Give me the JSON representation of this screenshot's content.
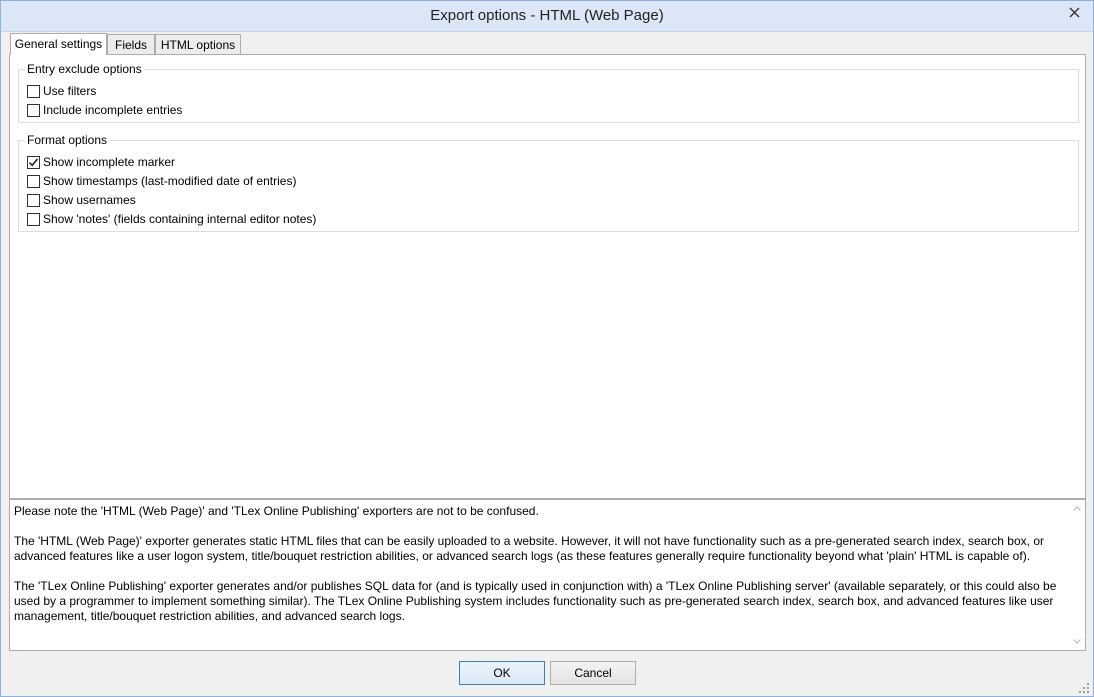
{
  "window": {
    "title": "Export options - HTML (Web Page)"
  },
  "tabs": [
    {
      "label": "General settings",
      "active": true
    },
    {
      "label": "Fields",
      "active": false
    },
    {
      "label": "HTML options",
      "active": false
    }
  ],
  "entry_exclude": {
    "legend": "Entry exclude options",
    "options": [
      {
        "label": "Use filters",
        "checked": false
      },
      {
        "label": "Include incomplete entries",
        "checked": false
      }
    ]
  },
  "format_options": {
    "legend": "Format options",
    "options": [
      {
        "label": "Show incomplete marker",
        "checked": true
      },
      {
        "label": "Show timestamps (last-modified date of entries)",
        "checked": false
      },
      {
        "label": "Show usernames",
        "checked": false
      },
      {
        "label": "Show 'notes' (fields containing internal editor notes)",
        "checked": false
      }
    ]
  },
  "notes": {
    "paragraphs": [
      "Please note the 'HTML (Web Page)' and 'TLex Online Publishing' exporters are not to be confused.",
      "The 'HTML (Web Page)' exporter generates static HTML files that can be easily uploaded to a website. However, it will not have functionality such as a pre-generated search index, search box, or advanced features like a user logon system, title/bouquet restriction abilities, or advanced search logs (as these features generally require functionality beyond what 'plain' HTML is capable of).",
      "The 'TLex Online Publishing' exporter generates and/or publishes SQL data for (and is typically used in conjunction with) a 'TLex Online Publishing server' (available separately, or this could also be used by a programmer to implement something similar). The TLex Online Publishing system includes functionality such as pre-generated search index, search box, and advanced features like user management, title/bouquet restriction abilities, and advanced search logs."
    ]
  },
  "buttons": {
    "ok": "OK",
    "cancel": "Cancel"
  },
  "colors": {
    "titlebar": "#dbe7f6",
    "default_button_border": "#3c7fb1"
  }
}
